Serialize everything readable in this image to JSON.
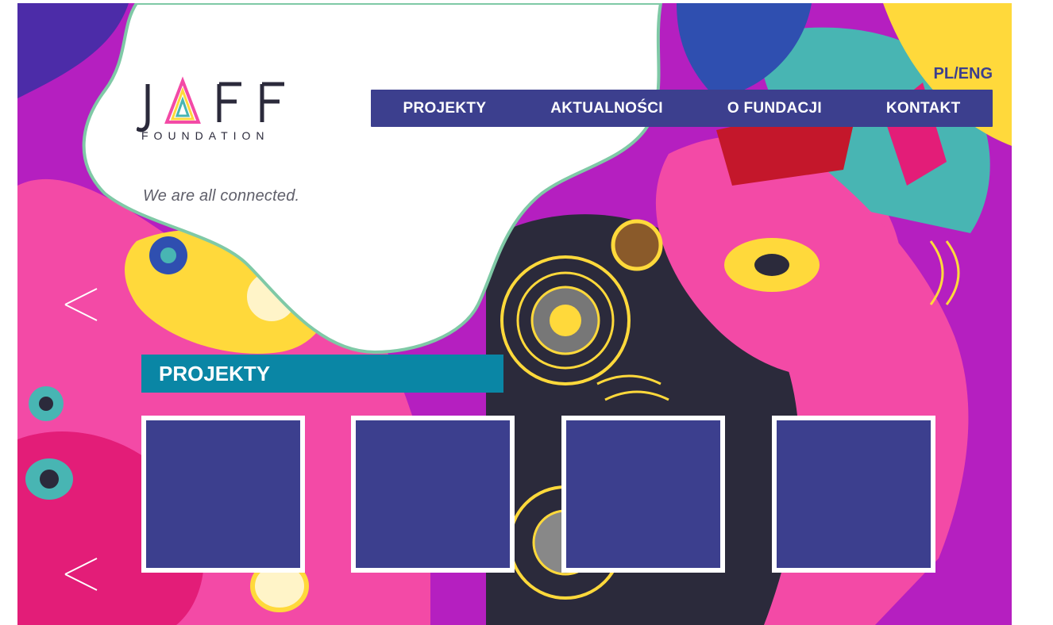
{
  "brand": {
    "logo_text": "JAFF",
    "logo_sub": "FOUNDATION",
    "tagline": "We are all connected."
  },
  "lang": {
    "pl": "PL",
    "sep": "/",
    "eng": "ENG"
  },
  "nav": {
    "items": [
      {
        "label": "PROJEKTY"
      },
      {
        "label": "AKTUALNOŚCI"
      },
      {
        "label": "O FUNDACJI"
      },
      {
        "label": "KONTAKT"
      }
    ]
  },
  "section": {
    "title": "PROJEKTY"
  },
  "colors": {
    "nav": "#3c3f8e",
    "section": "#0a86a5",
    "card": "#3c3f8e",
    "magenta": "#b51fc0",
    "pink": "#f34aa6",
    "yellow": "#ffd93b",
    "teal": "#48b5b3",
    "dark": "#2b2a3b"
  }
}
